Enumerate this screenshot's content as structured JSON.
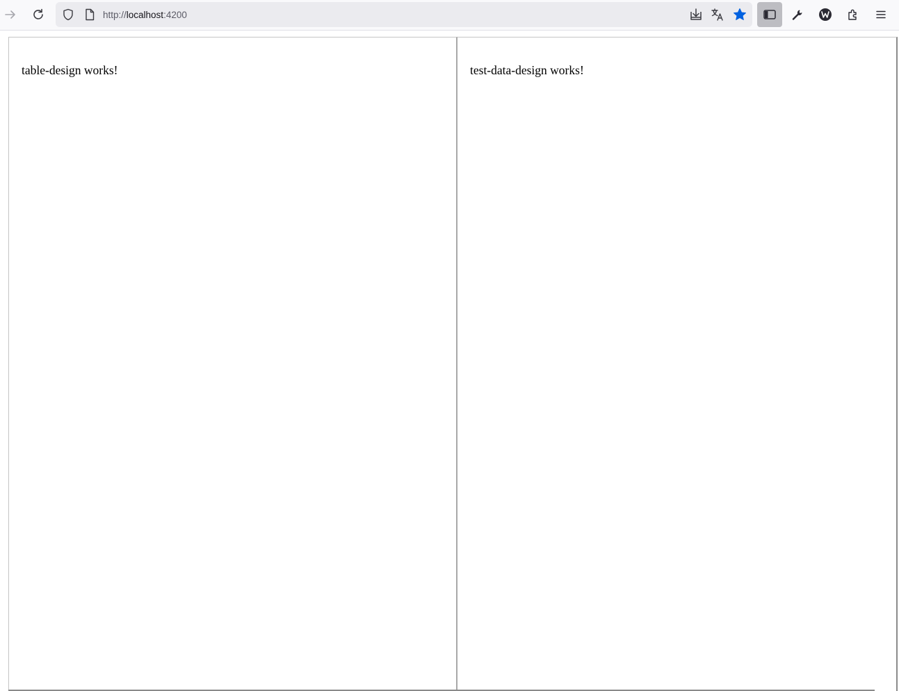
{
  "browser": {
    "nav": {
      "forward_icon": "arrow-right-icon",
      "reload_icon": "reload-icon"
    },
    "urlbar": {
      "security_icon": "shield-icon",
      "page_icon": "page-icon",
      "url_scheme": "http://",
      "url_host": "localhost",
      "url_port": ":4200"
    },
    "toolbar_icons": [
      "download-to-page-icon",
      "translate-icon",
      "bookmark-star-icon",
      "sidebar-icon",
      "wrench-icon",
      "w-extension-icon",
      "extensions-puzzle-icon",
      "menu-hamburger-icon"
    ],
    "colors": {
      "bookmark_star": "#0061e0",
      "sidebar_active_bg": "#bdbdc2"
    }
  },
  "page": {
    "left_frame": {
      "text": "table-design works!"
    },
    "right_frame": {
      "text": "test-data-design works!"
    }
  }
}
